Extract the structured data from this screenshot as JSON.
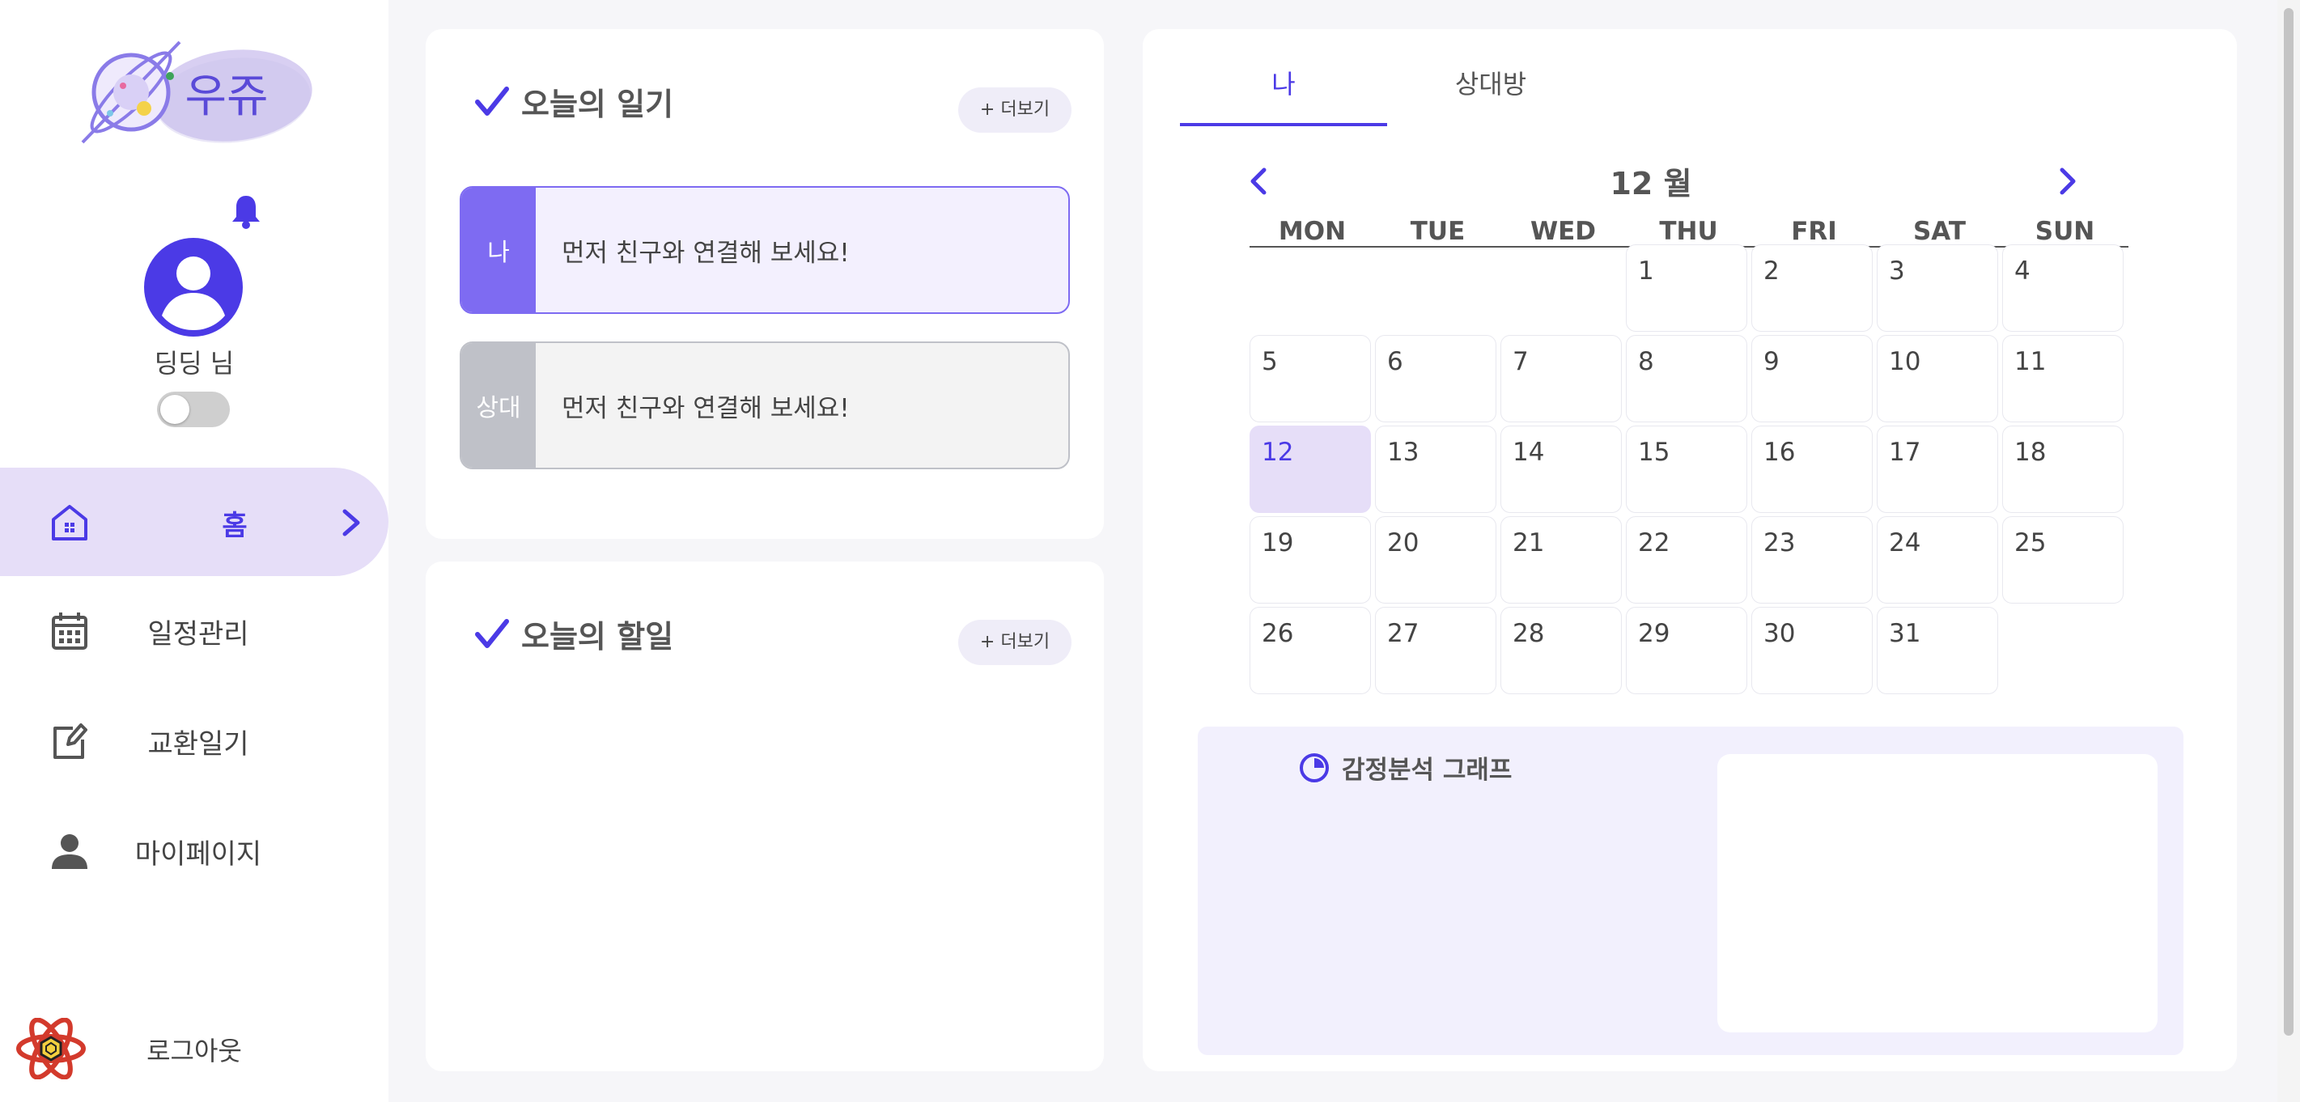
{
  "app": {
    "logo_text": "우쥬"
  },
  "profile": {
    "name": "딩딩 님"
  },
  "nav": {
    "items": [
      {
        "label": "홈",
        "icon": "home-icon",
        "active": true
      },
      {
        "label": "일정관리",
        "icon": "calendar-icon",
        "active": false
      },
      {
        "label": "교환일기",
        "icon": "edit-note-icon",
        "active": false
      },
      {
        "label": "마이페이지",
        "icon": "person-icon",
        "active": false
      }
    ],
    "logout": "로그아웃"
  },
  "diary": {
    "title": "오늘의 일기",
    "more": "+ 더보기",
    "entries": [
      {
        "tag": "나",
        "text": "먼저 친구와 연결해 보세요!"
      },
      {
        "tag": "상대",
        "text": "먼저 친구와 연결해 보세요!"
      }
    ]
  },
  "todo": {
    "title": "오늘의 할일",
    "more": "+ 더보기"
  },
  "calendar": {
    "tabs": [
      "나",
      "상대방"
    ],
    "month": "12 월",
    "weekdays": [
      "MON",
      "TUE",
      "WED",
      "THU",
      "FRI",
      "SAT",
      "SUN"
    ],
    "first_weekday_index": 3,
    "days_in_month": 31,
    "today": 12,
    "accent": "#4b3ae6",
    "today_bg": "#e6def8"
  },
  "emotion": {
    "title": "감정분석 그래프"
  }
}
